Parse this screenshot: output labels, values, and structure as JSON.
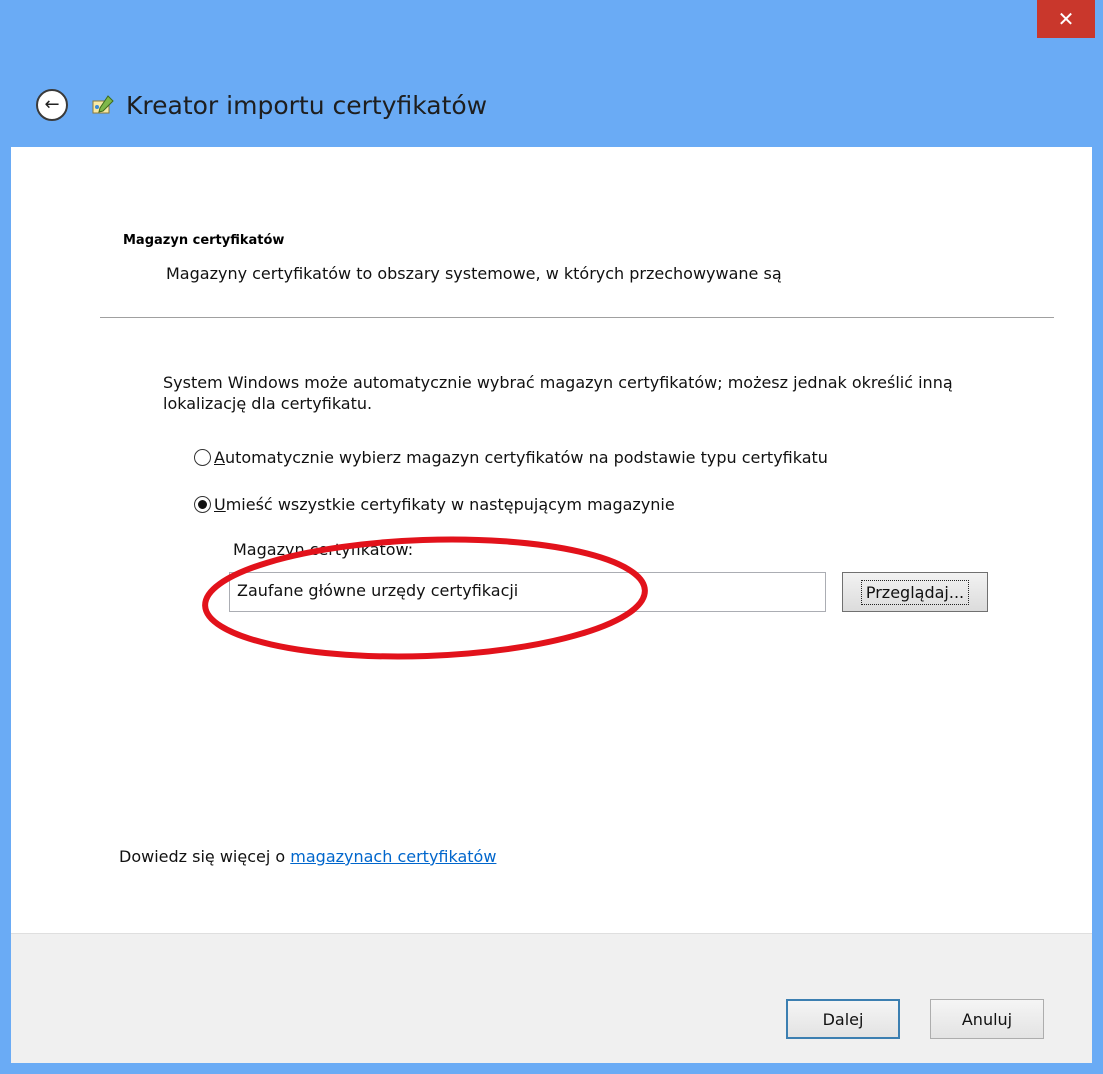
{
  "window": {
    "title": "Kreator importu certyfikatów",
    "close_icon": "close-icon",
    "titlebar_color": "#6aabf5"
  },
  "header": {
    "back_icon": "back-arrow-icon",
    "wizard_icon": "certificate-wizard-icon"
  },
  "page": {
    "section_title": "Magazyn certyfikatów",
    "section_description": "Magazyny certyfikatów to obszary systemowe, w których przechowywane są",
    "intro_text": "System Windows może automatycznie wybrać magazyn certyfikatów; możesz jednak określić inną lokalizację dla certyfikatu.",
    "options": [
      {
        "accesskey": "A",
        "rest": "utomatycznie wybierz magazyn certyfikatów na podstawie typu certyfikatu",
        "selected": false
      },
      {
        "accesskey": "U",
        "rest": "mieść wszystkie certyfikaty w następującym magazynie",
        "selected": true
      }
    ],
    "store_label": "Magazyn certyfikatów:",
    "store_value": "Zaufane główne urzędy certyfikacji",
    "browse_button": "Przeglądaj...",
    "learn_more_prefix": "Dowiedz się więcej o ",
    "learn_more_link": "magazynach certyfikatów"
  },
  "footer": {
    "next_button": "Dalej",
    "cancel_button": "Anuluj"
  },
  "annotation": {
    "shape": "ellipse",
    "color": "#e2121b"
  }
}
